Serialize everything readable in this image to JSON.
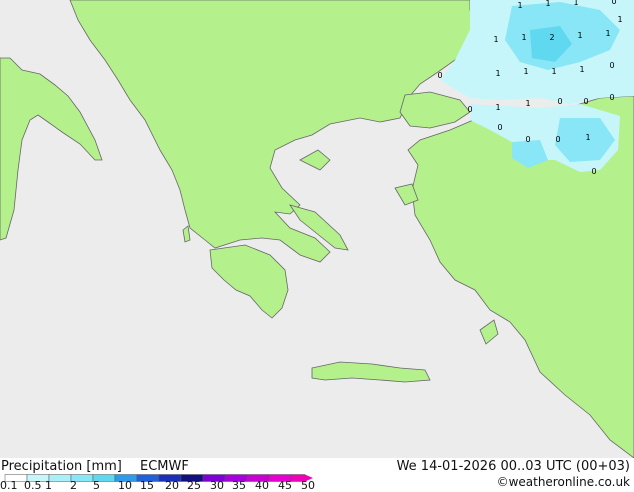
{
  "title": "Precipitation [mm]",
  "model": "ECMWF",
  "valid_time": "We 14-01-2026 00..03 UTC (00+03)",
  "credit": "©weatheronline.co.uk",
  "legend": {
    "ticks": [
      "0.1",
      "0.5",
      "1",
      "2",
      "5",
      "10",
      "15",
      "20",
      "25",
      "30",
      "35",
      "40",
      "45",
      "50"
    ],
    "colors": [
      "#ffffff",
      "#c6f6fa",
      "#aaf0fa",
      "#88e6f6",
      "#5fd8f0",
      "#2d9bea",
      "#2060d8",
      "#1c2fb8",
      "#10107e",
      "#7e00d4",
      "#a800dc",
      "#c800d4",
      "#e800d0",
      "#f000b8"
    ]
  },
  "map_colors": {
    "sea": "#ececec",
    "land": "#b4f08c",
    "coast": "#666666",
    "precip_light": "#c6f6fa",
    "precip_medium": "#88e6f6",
    "precip_heavy": "#5fd8f0"
  },
  "precip_values": [
    "1",
    "1",
    "1",
    "1",
    "1",
    "2",
    "1",
    "1",
    "1",
    "1",
    "1",
    "1",
    "1",
    "1",
    "1",
    "0",
    "0",
    "0",
    "0",
    "0",
    "0",
    "0",
    "0",
    "0",
    "0",
    "1",
    "0"
  ]
}
